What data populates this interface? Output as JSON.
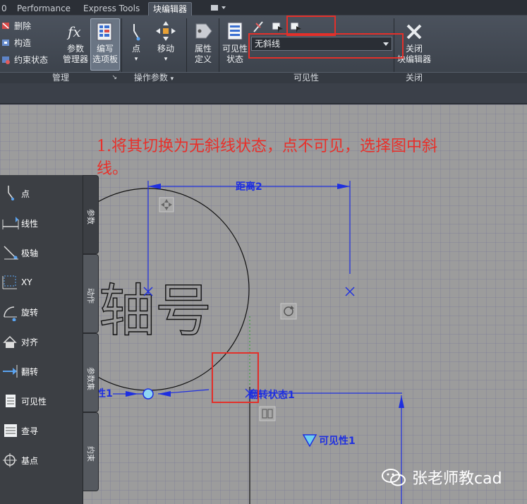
{
  "tabs": [
    {
      "label": "0"
    },
    {
      "label": "Performance"
    },
    {
      "label": "Express Tools"
    },
    {
      "label": "块编辑器"
    }
  ],
  "ribbon": {
    "manage": {
      "delete": "删除",
      "construct": "构造",
      "constraint_status": "约束状态",
      "param_manager_line1": "参数",
      "param_manager_line2": "管理器",
      "authoring_line1": "编写",
      "authoring_line2": "选项板",
      "label": "管理"
    },
    "action_params": {
      "point": "点",
      "move": "移动",
      "label": "操作参数"
    },
    "attr": {
      "line1": "属性",
      "line2": "定义"
    },
    "visibility": {
      "state_line1": "可见性",
      "state_line2": "状态",
      "selected_state": "无斜线",
      "label": "可见性"
    },
    "close": {
      "line1": "关闭",
      "line2": "块编辑器",
      "label": "关闭"
    }
  },
  "annotation": {
    "line1": "1.将其切换为无斜线状态，点不可见，选择图中斜",
    "line2": "线。"
  },
  "drawing": {
    "dim_label": "距离2",
    "flip_label": "翻转状态1",
    "visibility_label": "可见性1",
    "partial_label": "性1",
    "shaft_text": "轴号"
  },
  "palette": {
    "items": [
      "点",
      "线性",
      "极轴",
      "XY",
      "旋转",
      "对齐",
      "翻转",
      "可见性",
      "查寻",
      "基点"
    ],
    "tabs": [
      "参数",
      "动作",
      "参数集",
      "约束"
    ]
  },
  "watermark": "张老师教cad",
  "colors": {
    "accent_red": "#e3302a",
    "param_blue": "#1e2fe0"
  }
}
